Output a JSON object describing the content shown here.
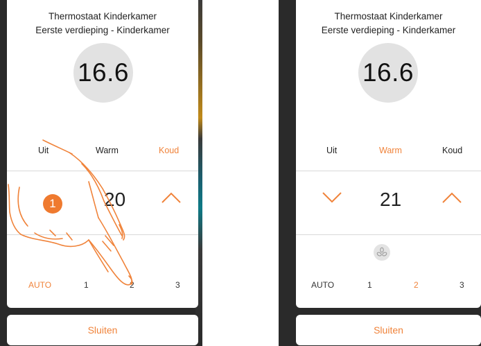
{
  "left": {
    "title_line1": "Thermostaat Kinderkamer",
    "title_line2": "Eerste verdieping - Kinderkamer",
    "temperature": "16.6",
    "modes": [
      "Uit",
      "Warm",
      "Koud"
    ],
    "active_mode": "Koud",
    "setpoint": "20",
    "fan_speeds": [
      "AUTO",
      "1",
      "2",
      "3"
    ],
    "active_fan": "AUTO",
    "step_badge": "1",
    "close_label": "Sluiten"
  },
  "right": {
    "title_line1": "Thermostaat Kinderkamer",
    "title_line2": "Eerste verdieping - Kinderkamer",
    "temperature": "16.6",
    "modes": [
      "Uit",
      "Warm",
      "Koud"
    ],
    "active_mode": "Warm",
    "setpoint": "21",
    "fan_speeds": [
      "AUTO",
      "1",
      "2",
      "3"
    ],
    "active_fan": "2",
    "close_label": "Sluiten"
  },
  "colors": {
    "accent": "#f0833a",
    "circle": "#e2e2e2",
    "background": "#2a2a2a"
  },
  "icons": {
    "up": "chevron-up-icon",
    "down": "chevron-down-icon",
    "fan": "fan-icon",
    "hand": "pointing-hand-icon"
  }
}
